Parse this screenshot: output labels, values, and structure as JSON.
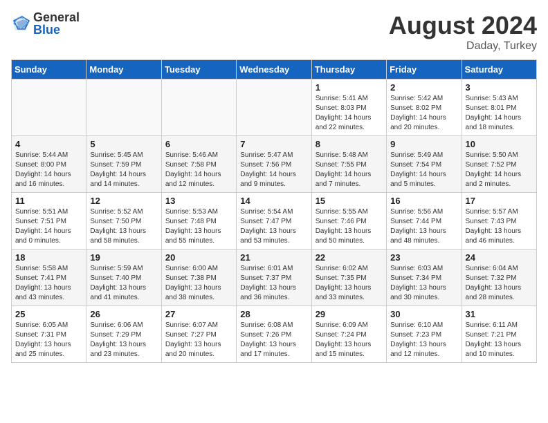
{
  "header": {
    "logo_general": "General",
    "logo_blue": "Blue",
    "month_year": "August 2024",
    "location": "Daday, Turkey"
  },
  "days_of_week": [
    "Sunday",
    "Monday",
    "Tuesday",
    "Wednesday",
    "Thursday",
    "Friday",
    "Saturday"
  ],
  "weeks": [
    [
      {
        "day": "",
        "info": ""
      },
      {
        "day": "",
        "info": ""
      },
      {
        "day": "",
        "info": ""
      },
      {
        "day": "",
        "info": ""
      },
      {
        "day": "1",
        "info": "Sunrise: 5:41 AM\nSunset: 8:03 PM\nDaylight: 14 hours\nand 22 minutes."
      },
      {
        "day": "2",
        "info": "Sunrise: 5:42 AM\nSunset: 8:02 PM\nDaylight: 14 hours\nand 20 minutes."
      },
      {
        "day": "3",
        "info": "Sunrise: 5:43 AM\nSunset: 8:01 PM\nDaylight: 14 hours\nand 18 minutes."
      }
    ],
    [
      {
        "day": "4",
        "info": "Sunrise: 5:44 AM\nSunset: 8:00 PM\nDaylight: 14 hours\nand 16 minutes."
      },
      {
        "day": "5",
        "info": "Sunrise: 5:45 AM\nSunset: 7:59 PM\nDaylight: 14 hours\nand 14 minutes."
      },
      {
        "day": "6",
        "info": "Sunrise: 5:46 AM\nSunset: 7:58 PM\nDaylight: 14 hours\nand 12 minutes."
      },
      {
        "day": "7",
        "info": "Sunrise: 5:47 AM\nSunset: 7:56 PM\nDaylight: 14 hours\nand 9 minutes."
      },
      {
        "day": "8",
        "info": "Sunrise: 5:48 AM\nSunset: 7:55 PM\nDaylight: 14 hours\nand 7 minutes."
      },
      {
        "day": "9",
        "info": "Sunrise: 5:49 AM\nSunset: 7:54 PM\nDaylight: 14 hours\nand 5 minutes."
      },
      {
        "day": "10",
        "info": "Sunrise: 5:50 AM\nSunset: 7:52 PM\nDaylight: 14 hours\nand 2 minutes."
      }
    ],
    [
      {
        "day": "11",
        "info": "Sunrise: 5:51 AM\nSunset: 7:51 PM\nDaylight: 14 hours\nand 0 minutes."
      },
      {
        "day": "12",
        "info": "Sunrise: 5:52 AM\nSunset: 7:50 PM\nDaylight: 13 hours\nand 58 minutes."
      },
      {
        "day": "13",
        "info": "Sunrise: 5:53 AM\nSunset: 7:48 PM\nDaylight: 13 hours\nand 55 minutes."
      },
      {
        "day": "14",
        "info": "Sunrise: 5:54 AM\nSunset: 7:47 PM\nDaylight: 13 hours\nand 53 minutes."
      },
      {
        "day": "15",
        "info": "Sunrise: 5:55 AM\nSunset: 7:46 PM\nDaylight: 13 hours\nand 50 minutes."
      },
      {
        "day": "16",
        "info": "Sunrise: 5:56 AM\nSunset: 7:44 PM\nDaylight: 13 hours\nand 48 minutes."
      },
      {
        "day": "17",
        "info": "Sunrise: 5:57 AM\nSunset: 7:43 PM\nDaylight: 13 hours\nand 46 minutes."
      }
    ],
    [
      {
        "day": "18",
        "info": "Sunrise: 5:58 AM\nSunset: 7:41 PM\nDaylight: 13 hours\nand 43 minutes."
      },
      {
        "day": "19",
        "info": "Sunrise: 5:59 AM\nSunset: 7:40 PM\nDaylight: 13 hours\nand 41 minutes."
      },
      {
        "day": "20",
        "info": "Sunrise: 6:00 AM\nSunset: 7:38 PM\nDaylight: 13 hours\nand 38 minutes."
      },
      {
        "day": "21",
        "info": "Sunrise: 6:01 AM\nSunset: 7:37 PM\nDaylight: 13 hours\nand 36 minutes."
      },
      {
        "day": "22",
        "info": "Sunrise: 6:02 AM\nSunset: 7:35 PM\nDaylight: 13 hours\nand 33 minutes."
      },
      {
        "day": "23",
        "info": "Sunrise: 6:03 AM\nSunset: 7:34 PM\nDaylight: 13 hours\nand 30 minutes."
      },
      {
        "day": "24",
        "info": "Sunrise: 6:04 AM\nSunset: 7:32 PM\nDaylight: 13 hours\nand 28 minutes."
      }
    ],
    [
      {
        "day": "25",
        "info": "Sunrise: 6:05 AM\nSunset: 7:31 PM\nDaylight: 13 hours\nand 25 minutes."
      },
      {
        "day": "26",
        "info": "Sunrise: 6:06 AM\nSunset: 7:29 PM\nDaylight: 13 hours\nand 23 minutes."
      },
      {
        "day": "27",
        "info": "Sunrise: 6:07 AM\nSunset: 7:27 PM\nDaylight: 13 hours\nand 20 minutes."
      },
      {
        "day": "28",
        "info": "Sunrise: 6:08 AM\nSunset: 7:26 PM\nDaylight: 13 hours\nand 17 minutes."
      },
      {
        "day": "29",
        "info": "Sunrise: 6:09 AM\nSunset: 7:24 PM\nDaylight: 13 hours\nand 15 minutes."
      },
      {
        "day": "30",
        "info": "Sunrise: 6:10 AM\nSunset: 7:23 PM\nDaylight: 13 hours\nand 12 minutes."
      },
      {
        "day": "31",
        "info": "Sunrise: 6:11 AM\nSunset: 7:21 PM\nDaylight: 13 hours\nand 10 minutes."
      }
    ]
  ]
}
